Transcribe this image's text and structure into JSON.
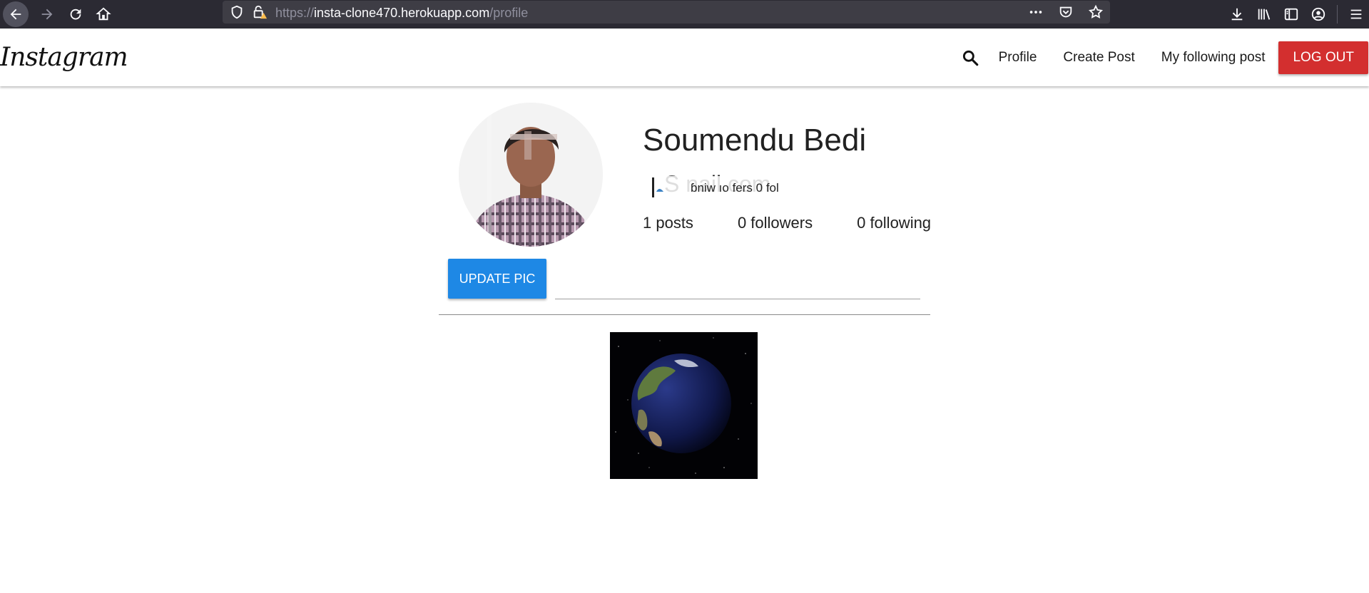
{
  "browser": {
    "url_scheme": "https://",
    "url_host": "insta-clone470.herokuapp.com",
    "url_path": "/profile",
    "icons": [
      "back-icon",
      "forward-icon",
      "reload-icon",
      "home-icon",
      "shield-icon",
      "lock-warning-icon",
      "more-icon",
      "pocket-icon",
      "star-icon",
      "download-icon",
      "library-icon",
      "sidebar-icon",
      "account-icon",
      "menu-icon"
    ]
  },
  "navbar": {
    "brand": "Instagram",
    "links": [
      "Profile",
      "Create Post",
      "My following post"
    ],
    "logout_label": "LOG OUT",
    "search_icon": "search-icon",
    "logout_color": "#d32f2f"
  },
  "profile": {
    "name": "Soumendu Bedi",
    "email_visible": "S                 nail.com",
    "glitch_text": "ɓniw  ıo  fers  0 fol",
    "stats": {
      "posts": "1 posts",
      "followers": "0 followers",
      "following": "0 following"
    },
    "update_label": "UPDATE PIC",
    "update_color": "#1e88e5"
  },
  "posts": [
    {
      "alt": "Earth globe"
    }
  ]
}
